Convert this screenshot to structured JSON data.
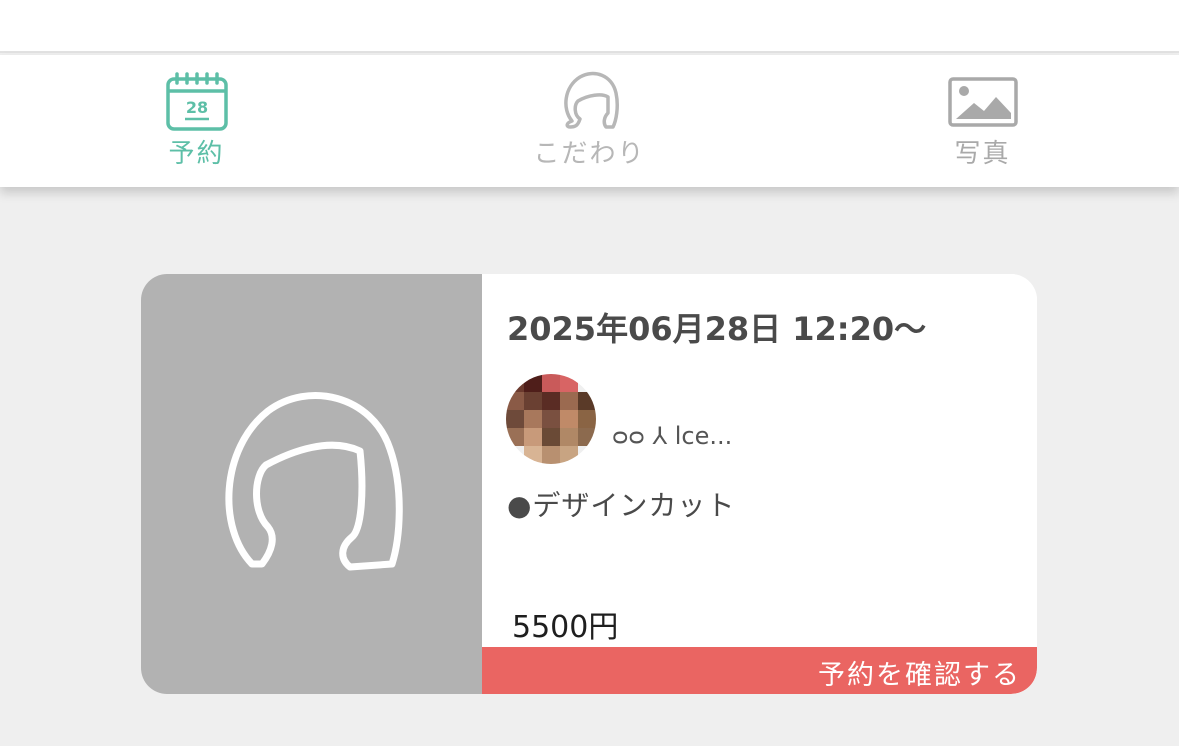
{
  "tabs": [
    {
      "id": "reserve",
      "label": "予約",
      "icon": "calendar-icon",
      "icon_text": "28",
      "active": true,
      "color": "#5dbfa7"
    },
    {
      "id": "kodawari",
      "label": "こだわり",
      "icon": "hair-silhouette-icon",
      "active": false,
      "color": "#b7b7b7"
    },
    {
      "id": "photo",
      "label": "写真",
      "icon": "image-icon",
      "active": false,
      "color": "#a9a9a9"
    }
  ],
  "reservation": {
    "datetime": "2025年06月28日 12:20〜",
    "stylist_name": "ᴑᴑ ⅄ lᴄe...",
    "menu": "●デザインカット",
    "price": "5500円",
    "confirm_label": "予約を確認する",
    "thumbnail_icon": "hair-silhouette-icon"
  },
  "colors": {
    "accent_green": "#5dbfa7",
    "confirm_red": "#ea6562",
    "thumb_gray": "#b2b2b2",
    "page_bg": "#efefef"
  }
}
